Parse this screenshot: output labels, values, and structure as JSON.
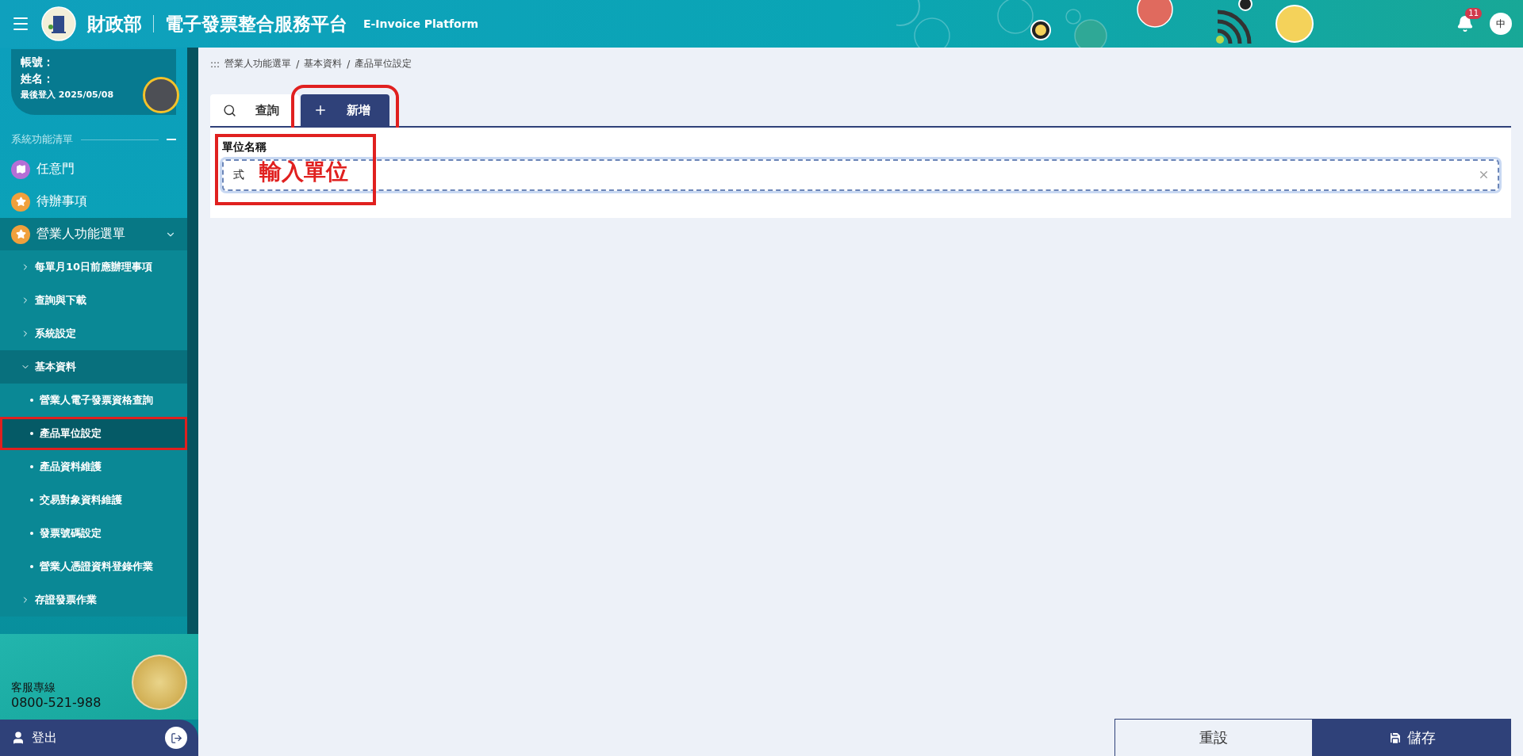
{
  "header": {
    "org": "財政部",
    "platform": "電子發票整合服務平台",
    "platform_en": "E-Invoice Platform",
    "notification_count": "11",
    "language": "中"
  },
  "user": {
    "account_label": "帳號：",
    "name_label": "姓名：",
    "last_login": "最後登入 2025/05/08"
  },
  "sidebar": {
    "section_title": "系統功能清單",
    "items": [
      {
        "label": "任意門",
        "kind": "map",
        "color": "#b46fd6"
      },
      {
        "label": "待辦事項",
        "kind": "star",
        "color": "#f0a03c"
      },
      {
        "label": "營業人功能選單",
        "kind": "star",
        "color": "#f0a03c",
        "expanded": true,
        "children": [
          {
            "label": "每單月10日前應辦理事項",
            "expanded": false
          },
          {
            "label": "查詢與下載",
            "expanded": false
          },
          {
            "label": "系統設定",
            "expanded": false
          },
          {
            "label": "基本資料",
            "expanded": true,
            "children": [
              {
                "label": "營業人電子發票資格查詢",
                "selected": false,
                "annotated": false
              },
              {
                "label": "產品單位設定",
                "selected": true,
                "annotated": true
              },
              {
                "label": "產品資料維護",
                "selected": false,
                "annotated": false
              },
              {
                "label": "交易對象資料維護",
                "selected": false,
                "annotated": false
              },
              {
                "label": "發票號碼設定",
                "selected": false,
                "annotated": false
              },
              {
                "label": "營業人憑證資料登錄作業",
                "selected": false,
                "annotated": false
              }
            ]
          },
          {
            "label": "存證發票作業",
            "expanded": false
          }
        ]
      }
    ]
  },
  "support": {
    "label": "客服專線",
    "phone": "0800-521-988"
  },
  "logout": {
    "label": "登出"
  },
  "breadcrumb": {
    "prefix": ":::",
    "separator": "/",
    "items": [
      "營業人功能選單",
      "基本資料",
      "產品單位設定"
    ]
  },
  "tabs": [
    {
      "label": "查詢",
      "kind": "search",
      "selected": false,
      "annotated": false
    },
    {
      "label": "新增",
      "kind": "add",
      "selected": true,
      "annotated": true
    }
  ],
  "form": {
    "fields": [
      {
        "label": "單位名稱",
        "value": "式",
        "annotated": true,
        "note": "輸入單位"
      }
    ]
  },
  "actions": [
    {
      "label": "重設",
      "kind": "reset"
    },
    {
      "label": "儲存",
      "kind": "save"
    }
  ]
}
